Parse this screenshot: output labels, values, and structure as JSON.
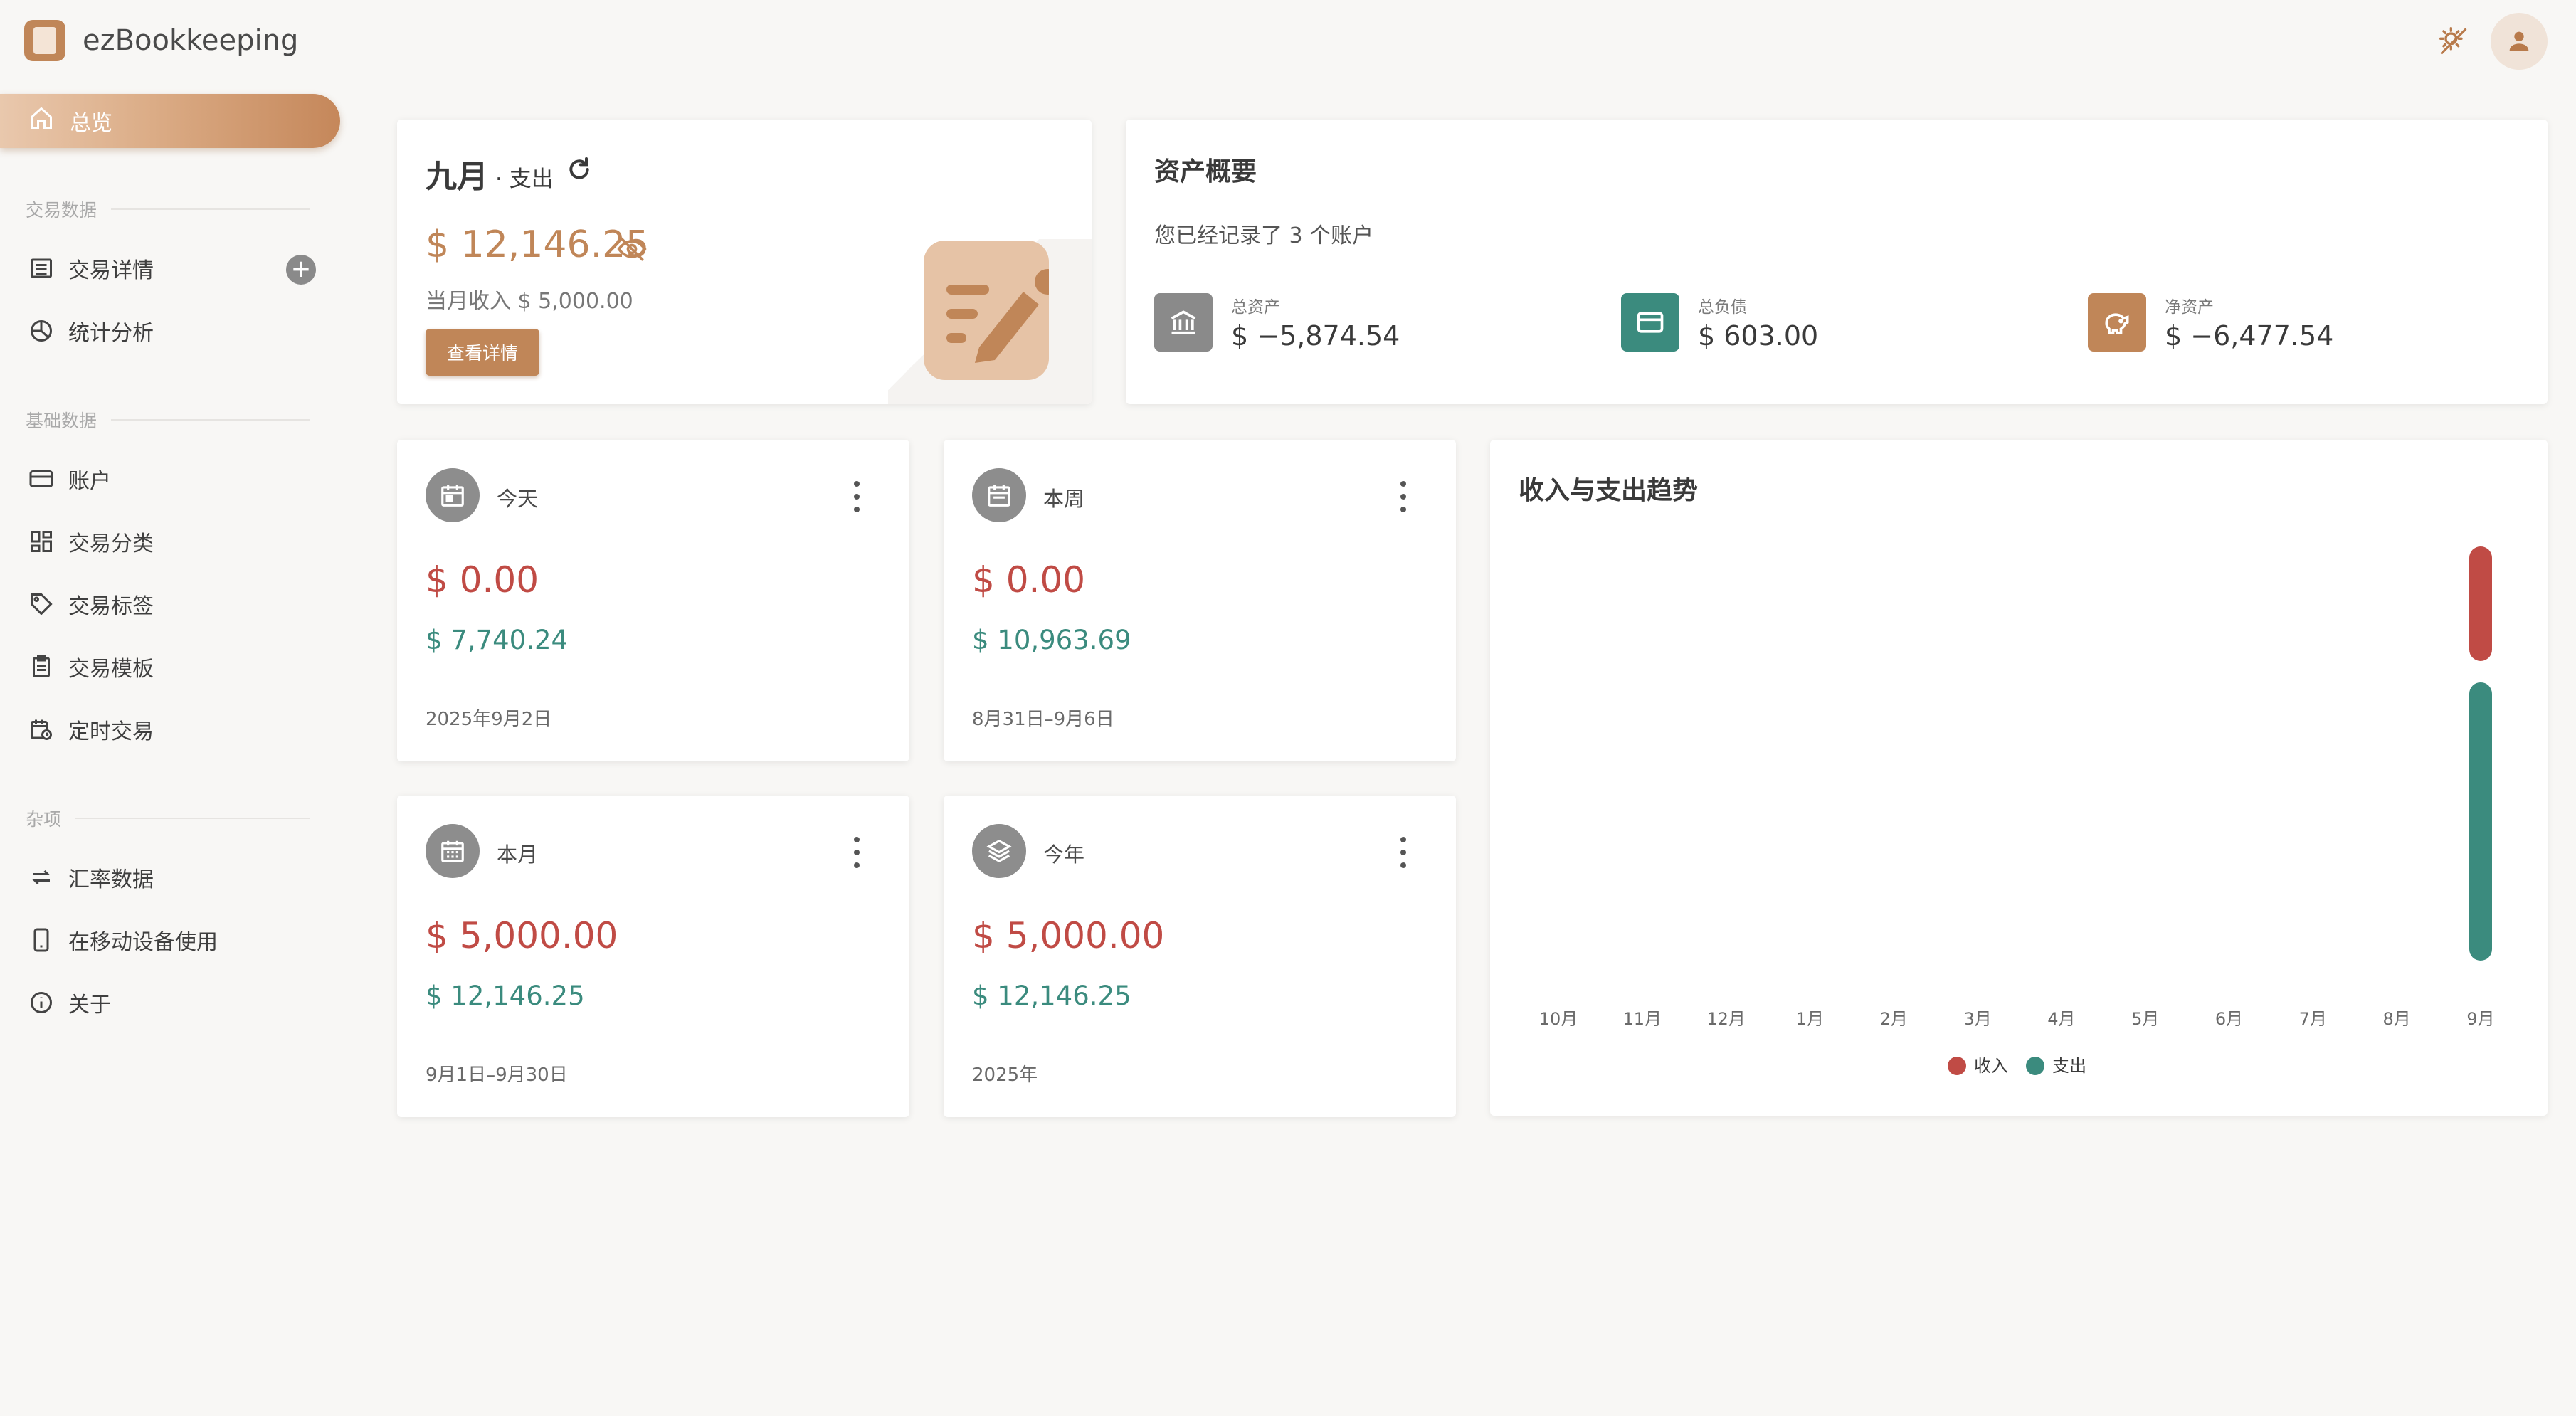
{
  "app": {
    "title": "ezBookkeeping"
  },
  "header": {
    "theme_icon": "theme-toggle-icon",
    "avatar_icon": "user-icon"
  },
  "sidebar": {
    "active": {
      "label": "总览",
      "icon": "home-icon"
    },
    "sections": {
      "transactions": "交易数据",
      "basic": "基础数据",
      "misc": "杂项"
    },
    "items": [
      {
        "label": "交易详情",
        "icon": "list-icon"
      },
      {
        "label": "统计分析",
        "icon": "pie-chart-icon"
      },
      {
        "label": "账户",
        "icon": "credit-card-icon"
      },
      {
        "label": "交易分类",
        "icon": "grid-icon"
      },
      {
        "label": "交易标签",
        "icon": "tag-icon"
      },
      {
        "label": "交易模板",
        "icon": "clipboard-icon"
      },
      {
        "label": "定时交易",
        "icon": "calendar-clock-icon"
      },
      {
        "label": "汇率数据",
        "icon": "exchange-icon"
      },
      {
        "label": "在移动设备使用",
        "icon": "mobile-icon"
      },
      {
        "label": "关于",
        "icon": "info-icon"
      }
    ],
    "add_label": "+"
  },
  "month_card": {
    "title": "九月",
    "subtitle": "· 支出",
    "amount": "$ 12,146.25",
    "income": "当月收入 $ 5,000.00",
    "details_button": "查看详情"
  },
  "asset_card": {
    "title": "资产概要",
    "note": "您已经记录了 3 个账户",
    "items": [
      {
        "label": "总资产",
        "value": "$ −5,874.54",
        "color": "#8a8a8a",
        "icon": "bank-icon"
      },
      {
        "label": "总负债",
        "value": "$ 603.00",
        "color": "#3b8b7e",
        "icon": "credit-card-icon"
      },
      {
        "label": "净资产",
        "value": "$ −6,477.54",
        "color": "#c08658",
        "icon": "piggy-bank-icon"
      }
    ]
  },
  "stats": [
    {
      "label": "今天",
      "expense": "$ 0.00",
      "income": "$ 7,740.24",
      "range": "2025年9月2日",
      "icon": "calendar-icon"
    },
    {
      "label": "本周",
      "expense": "$ 0.00",
      "income": "$ 10,963.69",
      "range": "8月31日–9月6日",
      "icon": "calendar-week-icon"
    },
    {
      "label": "本月",
      "expense": "$ 5,000.00",
      "income": "$ 12,146.25",
      "range": "9月1日–9月30日",
      "icon": "calendar-month-icon"
    },
    {
      "label": "今年",
      "expense": "$ 5,000.00",
      "income": "$ 12,146.25",
      "range": "2025年",
      "icon": "layers-icon"
    }
  ],
  "trend": {
    "title": "收入与支出趋势"
  },
  "chart_data": {
    "type": "bar",
    "title": "收入与支出趋势",
    "categories": [
      "10月",
      "11月",
      "12月",
      "1月",
      "2月",
      "3月",
      "4月",
      "5月",
      "6月",
      "7月",
      "8月",
      "9月"
    ],
    "series": [
      {
        "name": "收入",
        "color": "#c04b45",
        "values": [
          0,
          0,
          0,
          0,
          0,
          0,
          0,
          0,
          0,
          0,
          0,
          5000
        ]
      },
      {
        "name": "支出",
        "color": "#3b8b7e",
        "values": [
          0,
          0,
          0,
          0,
          0,
          0,
          0,
          0,
          0,
          0,
          0,
          12146.25
        ]
      }
    ],
    "stacked": true,
    "legend": "bottom-center",
    "grid": false
  }
}
